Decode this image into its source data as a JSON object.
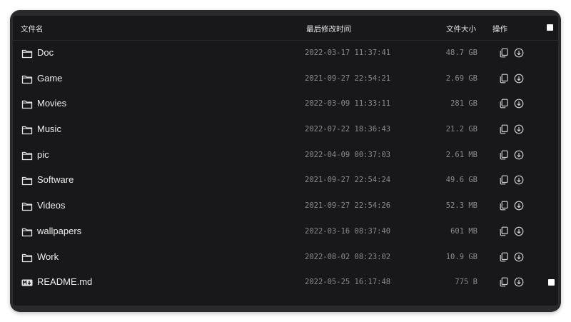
{
  "header": {
    "name": "文件名",
    "modified": "最后修改时间",
    "size": "文件大小",
    "actions": "操作"
  },
  "rows": [
    {
      "name": "Doc",
      "icon": "folder-icon",
      "modified": "2022-03-17 11:37:41",
      "size": "48.7 GB",
      "checkbox": false
    },
    {
      "name": "Game",
      "icon": "folder-icon",
      "modified": "2021-09-27 22:54:21",
      "size": "2.69 GB",
      "checkbox": false
    },
    {
      "name": "Movies",
      "icon": "folder-icon",
      "modified": "2022-03-09 11:33:11",
      "size": "281 GB",
      "checkbox": false
    },
    {
      "name": "Music",
      "icon": "folder-icon",
      "modified": "2022-07-22 18:36:43",
      "size": "21.2 GB",
      "checkbox": false
    },
    {
      "name": "pic",
      "icon": "folder-icon",
      "modified": "2022-04-09 00:37:03",
      "size": "2.61 MB",
      "checkbox": false
    },
    {
      "name": "Software",
      "icon": "folder-icon",
      "modified": "2021-09-27 22:54:24",
      "size": "49.6 GB",
      "checkbox": false
    },
    {
      "name": "Videos",
      "icon": "folder-icon",
      "modified": "2021-09-27 22:54:26",
      "size": "52.3 MB",
      "checkbox": false
    },
    {
      "name": "wallpapers",
      "icon": "folder-icon",
      "modified": "2022-03-16 08:37:40",
      "size": "601 MB",
      "checkbox": false
    },
    {
      "name": "Work",
      "icon": "folder-icon",
      "modified": "2022-08-02 08:23:02",
      "size": "10.9 GB",
      "checkbox": false
    },
    {
      "name": "README.md",
      "icon": "markdown-icon",
      "modified": "2022-05-25 16:17:48",
      "size": "775 B",
      "checkbox": true
    }
  ],
  "colors": {
    "background": "#18181b",
    "frame": "#2a2a2d",
    "text": "#eeeeee",
    "muted": "#8a8a8e"
  }
}
